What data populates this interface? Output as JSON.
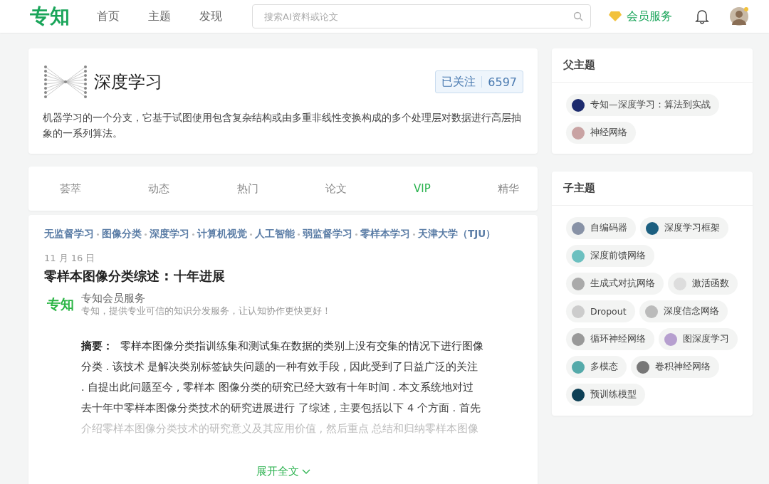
{
  "header": {
    "logo": "专知",
    "nav": [
      {
        "label": "首页",
        "selected": false
      },
      {
        "label": "主题",
        "selected": false
      },
      {
        "label": "发现",
        "selected": false
      }
    ],
    "search": {
      "placeholder": "搜索AI资料或论文"
    },
    "vip": "会员服务"
  },
  "topic": {
    "title": "深度学习",
    "follow": "已关注",
    "followers": "6597",
    "description": "机器学习的一个分支，它基于试图使用包含复杂结构或由多重非线性变换构成的多个处理层对数据进行高层抽象的一系列算法。"
  },
  "tabs": [
    {
      "label": "荟萃",
      "selected": false
    },
    {
      "label": "动态",
      "selected": false
    },
    {
      "label": "热门",
      "selected": false
    },
    {
      "label": "论文",
      "selected": false
    },
    {
      "label": "VIP",
      "selected": true
    },
    {
      "label": "精华",
      "selected": false
    }
  ],
  "article": {
    "tags": [
      "无监督学习",
      "图像分类",
      "深度学习",
      "计算机视觉",
      "人工智能",
      "弱监督学习",
      "零样本学习",
      "天津大学（TJU）"
    ],
    "date": "11 月 16 日",
    "title": "零样本图像分类综述 : 十年进展",
    "source": {
      "logo": "专知",
      "name": "专知会员服务",
      "slogan": "专知，提供专业可信的知识分发服务，让认知协作更快更好！"
    },
    "abstract_label": "摘要：",
    "abstract_lines": [
      "零样本图像分类指训练集和测试集在数据的类别上没有交集的情况下进行图像",
      "分类 . 该技术 是解决类别标签缺失问题的一种有效手段 , 因此受到了日益广泛的关注",
      ". 自提出此问题至今 , 零样本 图像分类的研究已经大致有十年时间 . 本文系统地对过",
      "去十年中零样本图像分类技术的研究进展进行 了综述 , 主要包括以下 4 个方面 . 首先",
      "介绍零样本图像分类技术的研究意义及其应用价值 , 然后重点 总结和归纳零样本图像"
    ],
    "expand": "展开全文"
  },
  "sidebar": [
    {
      "title": "父主题",
      "chips": [
        "专知—深度学习：算法到实战",
        "神经网络"
      ]
    },
    {
      "title": "子主题",
      "chips": [
        "自编码器",
        "深度学习框架",
        "深度前馈网络",
        "生成式对抗网络",
        "激活函数",
        "Dropout",
        "深度信念网络",
        "循环神经网络",
        "图深度学习",
        "多模态",
        "卷积神经网络",
        "预训练模型"
      ]
    }
  ]
}
